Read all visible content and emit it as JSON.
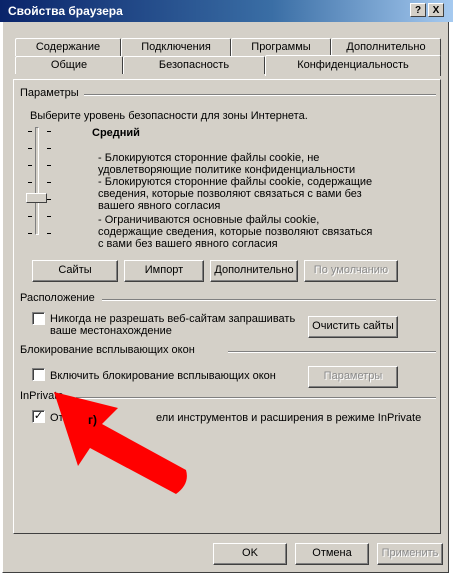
{
  "window": {
    "title": "Свойства браузера",
    "help_button": "?",
    "close_button": "X"
  },
  "tabs": {
    "row_back": [
      "Содержание",
      "Подключения",
      "Программы",
      "Дополнительно"
    ],
    "row_front": [
      "Общие",
      "Безопасность",
      "Конфиденциальность"
    ],
    "active": "Конфиденциальность"
  },
  "settings": {
    "group_title": "Параметры",
    "instruction": "Выберите уровень безопасности для зоны Интернета.",
    "level_name": "Средний",
    "description_lines": [
      "- Блокируются сторонние файлы cookie, не",
      "удовлетворяющие политике конфиденциальности",
      "- Блокируются сторонние файлы cookie, содержащие",
      "сведения, которые позволяют связаться с вами без",
      "вашего явного согласия",
      "- Ограничиваются основные файлы cookie,",
      "содержащие сведения, которые позволяют связаться",
      "с вами без вашего явного согласия"
    ],
    "buttons": {
      "sites": "Сайты",
      "import": "Импорт",
      "advanced": "Дополнительно",
      "default": "По умолчанию"
    }
  },
  "location": {
    "group_title": "Расположение",
    "checkbox_label_lines": [
      "Никогда не разрешать веб-сайтам запрашивать",
      "ваше местонахождение"
    ],
    "checked": false,
    "clear_sites_button": "Очистить сайты"
  },
  "popup": {
    "group_title": "Блокирование всплывающих окон",
    "checkbox_label": "Включить блокирование всплывающих окон",
    "checked": false,
    "settings_button": "Параметры"
  },
  "inprivate": {
    "group_title": "InPrivate",
    "checkbox_label_start": "Отк",
    "checkbox_label_end": "ели инструментов и расширения в режиме InPrivate",
    "checked": true
  },
  "annotation": {
    "label": "г)",
    "arrow_color": "#ff0000"
  },
  "footer": {
    "ok": "OK",
    "cancel": "Отмена",
    "apply": "Применить"
  },
  "colors": {
    "dialog_bg": "#d4d0c8",
    "title_start": "#0a246a",
    "title_end": "#a6caf0"
  }
}
